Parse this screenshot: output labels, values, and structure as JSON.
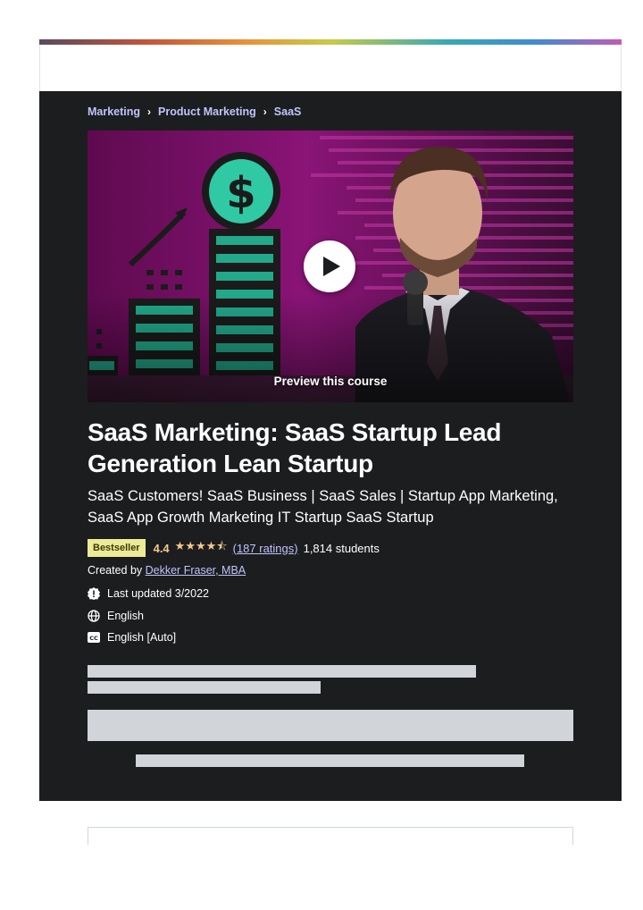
{
  "breadcrumb": {
    "items": [
      "Marketing",
      "Product Marketing",
      "SaaS"
    ],
    "separator": "›"
  },
  "preview": {
    "label": "Preview this course",
    "play_icon": "play-icon"
  },
  "course": {
    "title": "SaaS Marketing: SaaS Startup Lead Generation Lean Startup",
    "subtitle": "SaaS Customers! SaaS Business | SaaS Sales | Startup App Marketing, SaaS App Growth Marketing IT Startup SaaS Startup",
    "badge": "Bestseller",
    "rating": "4.4",
    "stars": "★★★★⯪",
    "ratings_count": "(187 ratings)",
    "students": "1,814 students",
    "created_by_prefix": "Created by",
    "instructor": "Dekker Fraser, MBA",
    "last_updated": "Last updated 3/2022",
    "language": "English",
    "captions": "English [Auto]"
  },
  "colors": {
    "panel_bg": "#1c1d1f",
    "link": "#c0c4fc",
    "rating": "#f3ca8c",
    "badge_bg": "#eceb98",
    "skeleton": "#d1d4d8"
  }
}
